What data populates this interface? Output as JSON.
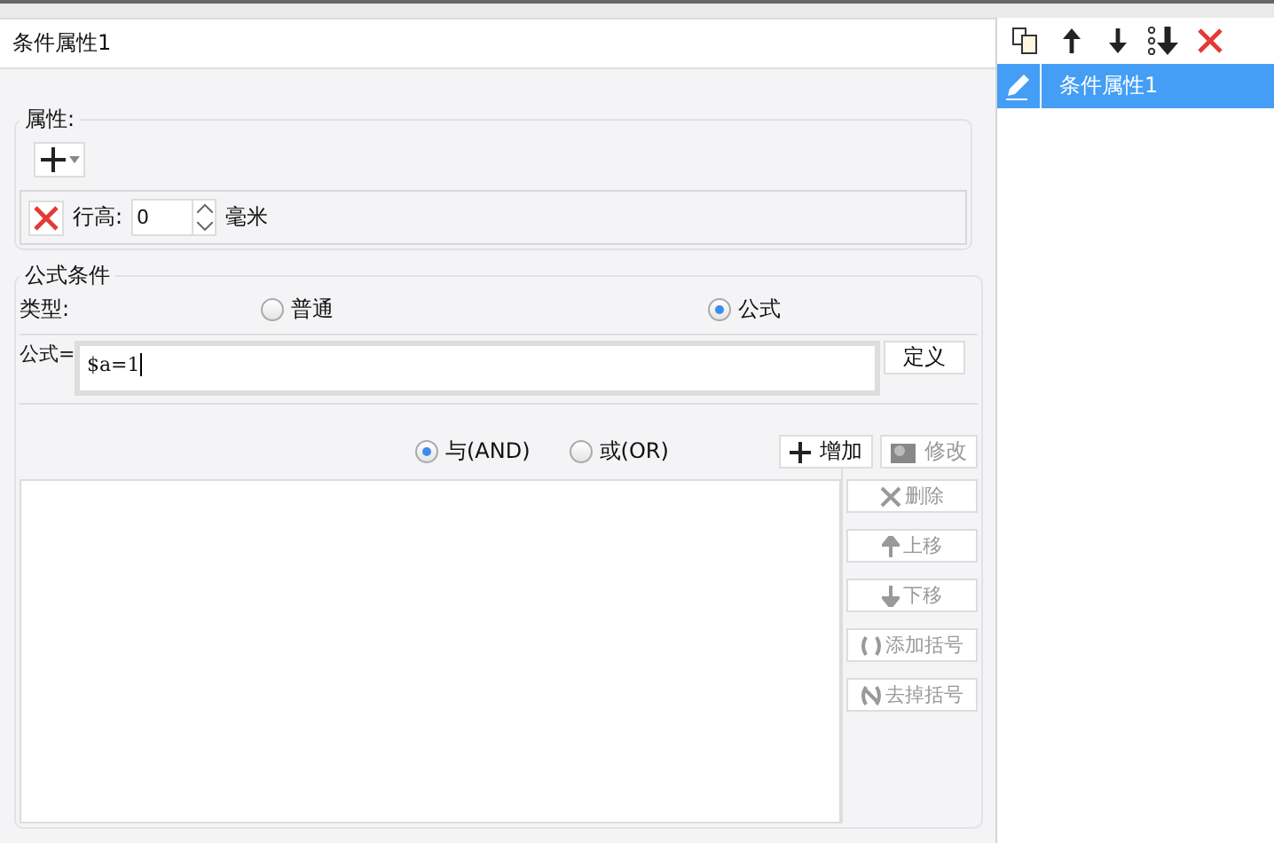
{
  "title": "条件属性1",
  "properties": {
    "legend": "属性:",
    "rows": [
      {
        "label": "行高:",
        "value": "0",
        "unit": "毫米"
      }
    ]
  },
  "formula_condition": {
    "legend": "公式条件",
    "type_label": "类型:",
    "types": [
      {
        "label": "普通",
        "selected": false
      },
      {
        "label": "公式",
        "selected": true
      }
    ],
    "formula_label": "公式=",
    "formula_value": "$a=1",
    "define_button": "定义",
    "logic": [
      {
        "label": "与(AND)",
        "selected": true
      },
      {
        "label": "或(OR)",
        "selected": false
      }
    ],
    "top_buttons": [
      {
        "label": "增加",
        "disabled": false
      },
      {
        "label": "修改",
        "disabled": true
      }
    ],
    "side_buttons": [
      {
        "label": "删除",
        "disabled": true
      },
      {
        "label": "上移",
        "disabled": true
      },
      {
        "label": "下移",
        "disabled": true
      },
      {
        "label": "添加括号",
        "disabled": true
      },
      {
        "label": "去掉括号",
        "disabled": true
      }
    ]
  },
  "condition_list": {
    "items": [
      {
        "label": "条件属性1",
        "selected": true
      }
    ]
  }
}
